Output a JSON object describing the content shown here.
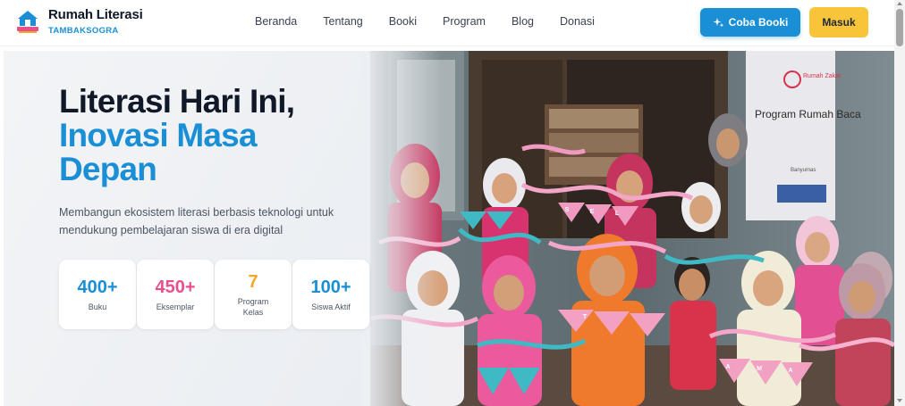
{
  "brand": {
    "name": "Rumah Literasi",
    "subtitle": "TAMBAKSOGRA"
  },
  "nav": {
    "links": [
      "Beranda",
      "Tentang",
      "Booki",
      "Program",
      "Blog",
      "Donasi"
    ],
    "cta_primary": "Coba Booki",
    "cta_secondary": "Masuk"
  },
  "hero": {
    "title_line1": "Literasi Hari Ini,",
    "title_line2a": "Inovasi Masa",
    "title_line2b": "Depan",
    "description": "Membangun ekosistem literasi berbasis teknologi untuk mendukung pembelajaran siswa di era digital",
    "photo_signs": [
      "Rumah Zakat",
      "Program Rumah Baca",
      "Banyumas"
    ],
    "banner_letters": [
      "S",
      "E",
      "L",
      "A",
      "M",
      "A",
      "T"
    ],
    "stats": [
      {
        "value": "400+",
        "label": "Buku",
        "color": "#1a8fd6"
      },
      {
        "value": "450+",
        "label": "Eksemplar",
        "color": "#e8508d"
      },
      {
        "value": "7",
        "label": "Program Kelas",
        "color": "#f5a623"
      },
      {
        "value": "100+",
        "label": "Siswa Aktif",
        "color": "#1a8fd6"
      }
    ]
  },
  "colors": {
    "brand": "#1a8fd6",
    "accent": "#f8c53a",
    "pink": "#e8508d"
  }
}
